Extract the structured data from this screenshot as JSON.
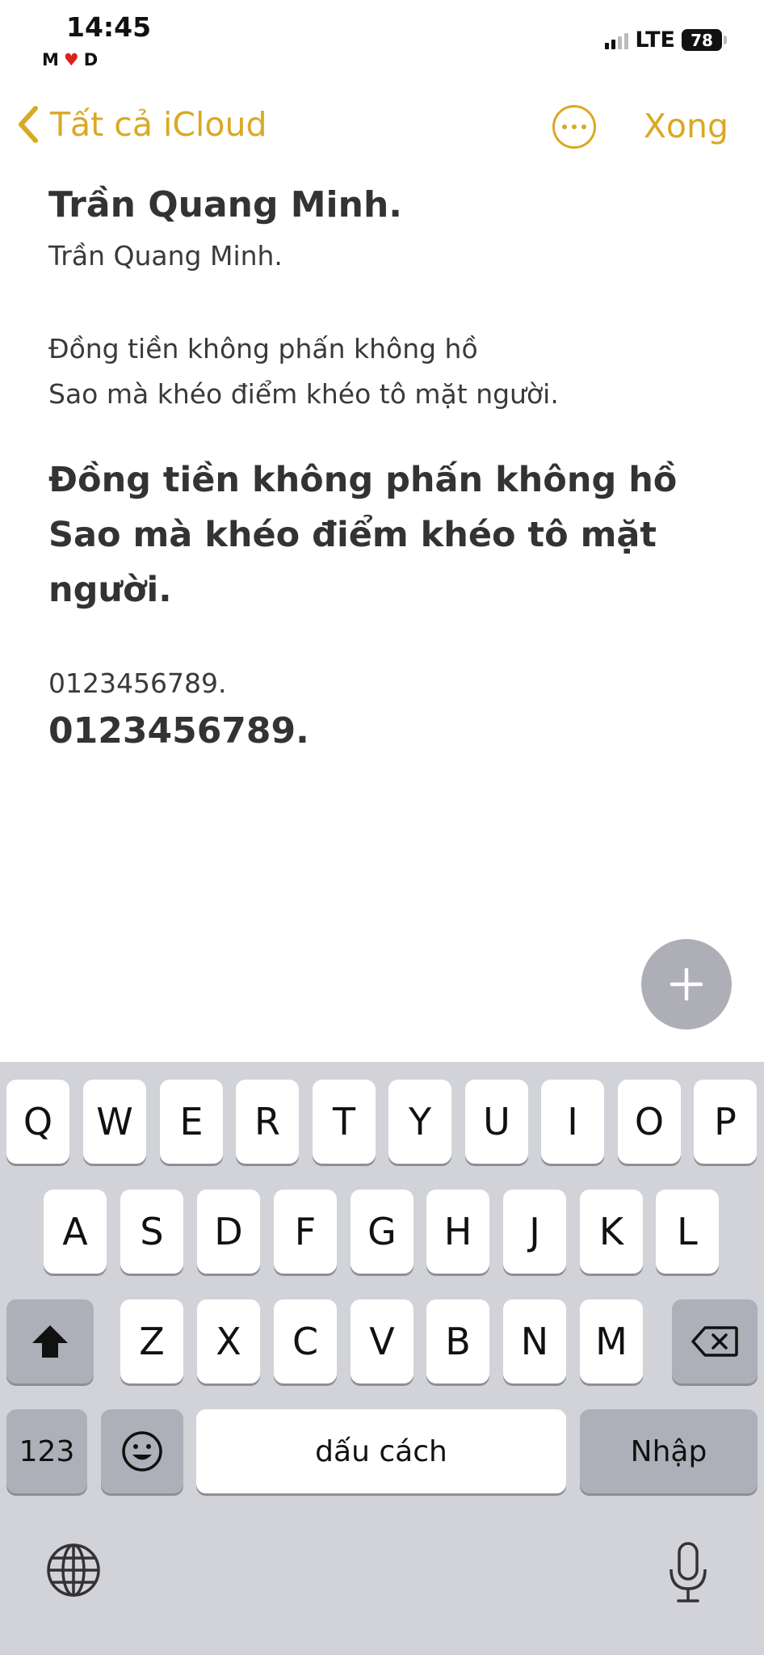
{
  "status": {
    "time": "14:45",
    "left_label_m": "M",
    "left_label_d": "D",
    "network": "LTE",
    "battery": "78"
  },
  "nav": {
    "back_label": "Tất cả iCloud",
    "done_label": "Xong",
    "more_icon": "ellipsis-circle-icon",
    "accent_color": "#d9a924"
  },
  "note": {
    "title": "Trần Quang Minh.",
    "subtitle": "Trần Quang Minh.",
    "para1_line1": "Đồng tiền không phấn không hồ",
    "para1_line2": "Sao mà khéo điểm khéo tô mặt người.",
    "para2": "Đồng tiền không phấn không hồ Sao mà khéo điểm khéo tô mặt người.",
    "number_small": "0123456789.",
    "number_large": "0123456789."
  },
  "keyboard": {
    "row1": [
      "Q",
      "W",
      "E",
      "R",
      "T",
      "Y",
      "U",
      "I",
      "O",
      "P"
    ],
    "row2": [
      "A",
      "S",
      "D",
      "F",
      "G",
      "H",
      "J",
      "K",
      "L"
    ],
    "row3": [
      "Z",
      "X",
      "C",
      "V",
      "B",
      "N",
      "M"
    ],
    "numbers_key": "123",
    "space_key": "dấu cách",
    "return_key": "Nhập",
    "shift_icon": "shift-icon",
    "delete_icon": "delete-icon",
    "emoji_icon": "emoji-icon",
    "globe_icon": "globe-icon",
    "mic_icon": "microphone-icon"
  }
}
